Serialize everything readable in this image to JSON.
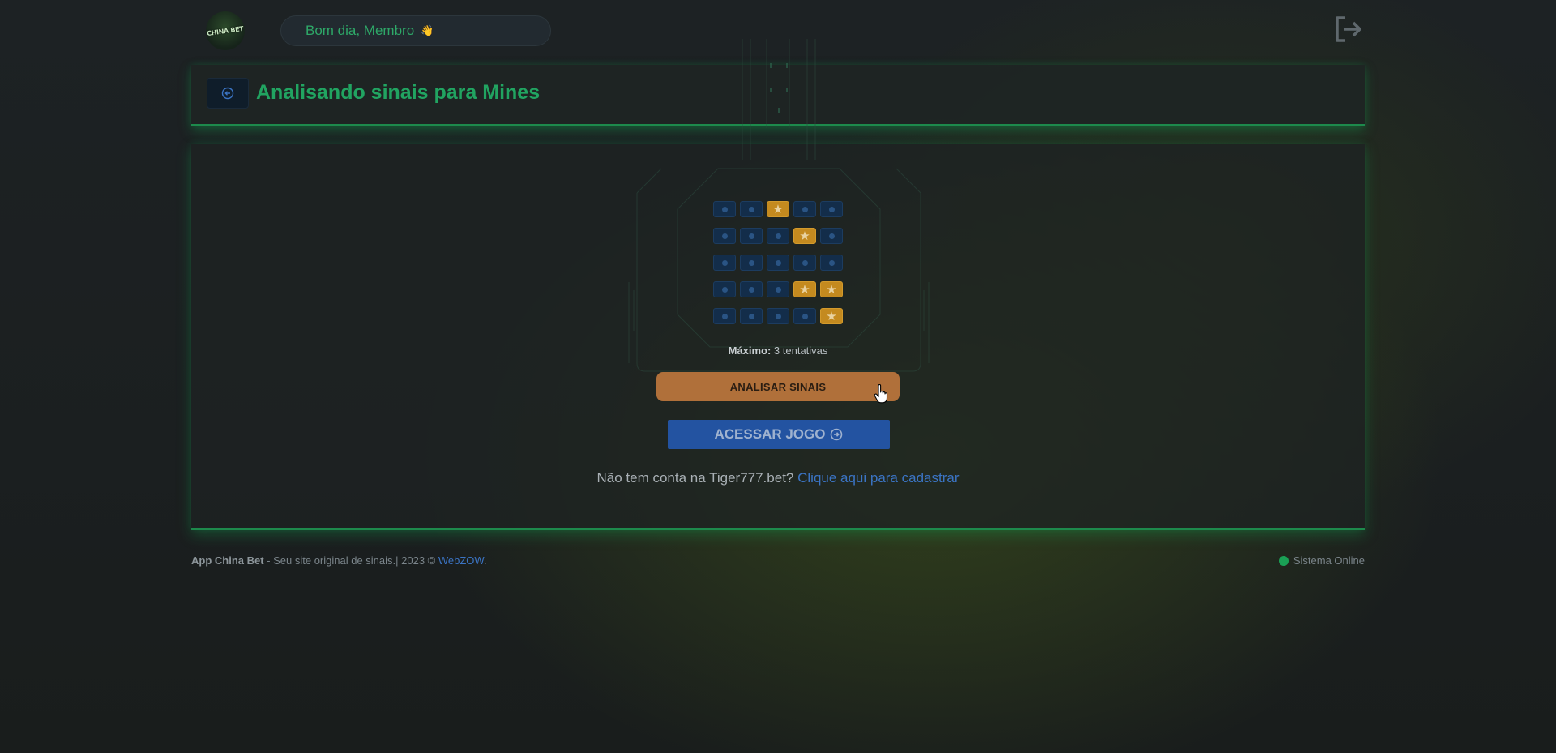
{
  "header": {
    "logo_text": "CHINA BET",
    "greeting": "Bom dia, Membro",
    "greeting_emoji": "👋",
    "logout_icon": "logout-icon"
  },
  "title_card": {
    "back_icon": "arrow-left-circle-icon",
    "title": "Analisando sinais para Mines"
  },
  "mines_grid": {
    "rows": 5,
    "cols": 5,
    "cells": [
      [
        "dot",
        "dot",
        "star",
        "dot",
        "dot"
      ],
      [
        "dot",
        "dot",
        "dot",
        "star",
        "dot"
      ],
      [
        "dot",
        "dot",
        "dot",
        "dot",
        "dot"
      ],
      [
        "dot",
        "dot",
        "dot",
        "star",
        "star"
      ],
      [
        "dot",
        "dot",
        "dot",
        "dot",
        "star"
      ]
    ],
    "star_glyph": "★"
  },
  "analysis": {
    "max_label": "Máximo:",
    "max_value": "3 tentativas",
    "analyze_button": "ANALISAR SINAIS"
  },
  "access": {
    "button_label": "ACESSAR JOGO",
    "button_icon": "arrow-right-circle-icon"
  },
  "signup": {
    "text": "Não tem conta na Tiger777.bet?",
    "link": "Clique aqui para cadastrar"
  },
  "footer": {
    "brand": "App China Bet",
    "tagline": " - Seu site original de sinais.| 2023 © ",
    "credit_link": "WebZOW",
    "after_link": ".",
    "status": "Sistema Online"
  },
  "colors": {
    "accent_green": "#21a461",
    "star_gold": "#c48a1f",
    "cell_blue": "#132d4a",
    "analyze_button": "#b0703a",
    "access_button": "#2353a1",
    "link_blue": "#3b74c4",
    "status_online": "#1aa055"
  }
}
